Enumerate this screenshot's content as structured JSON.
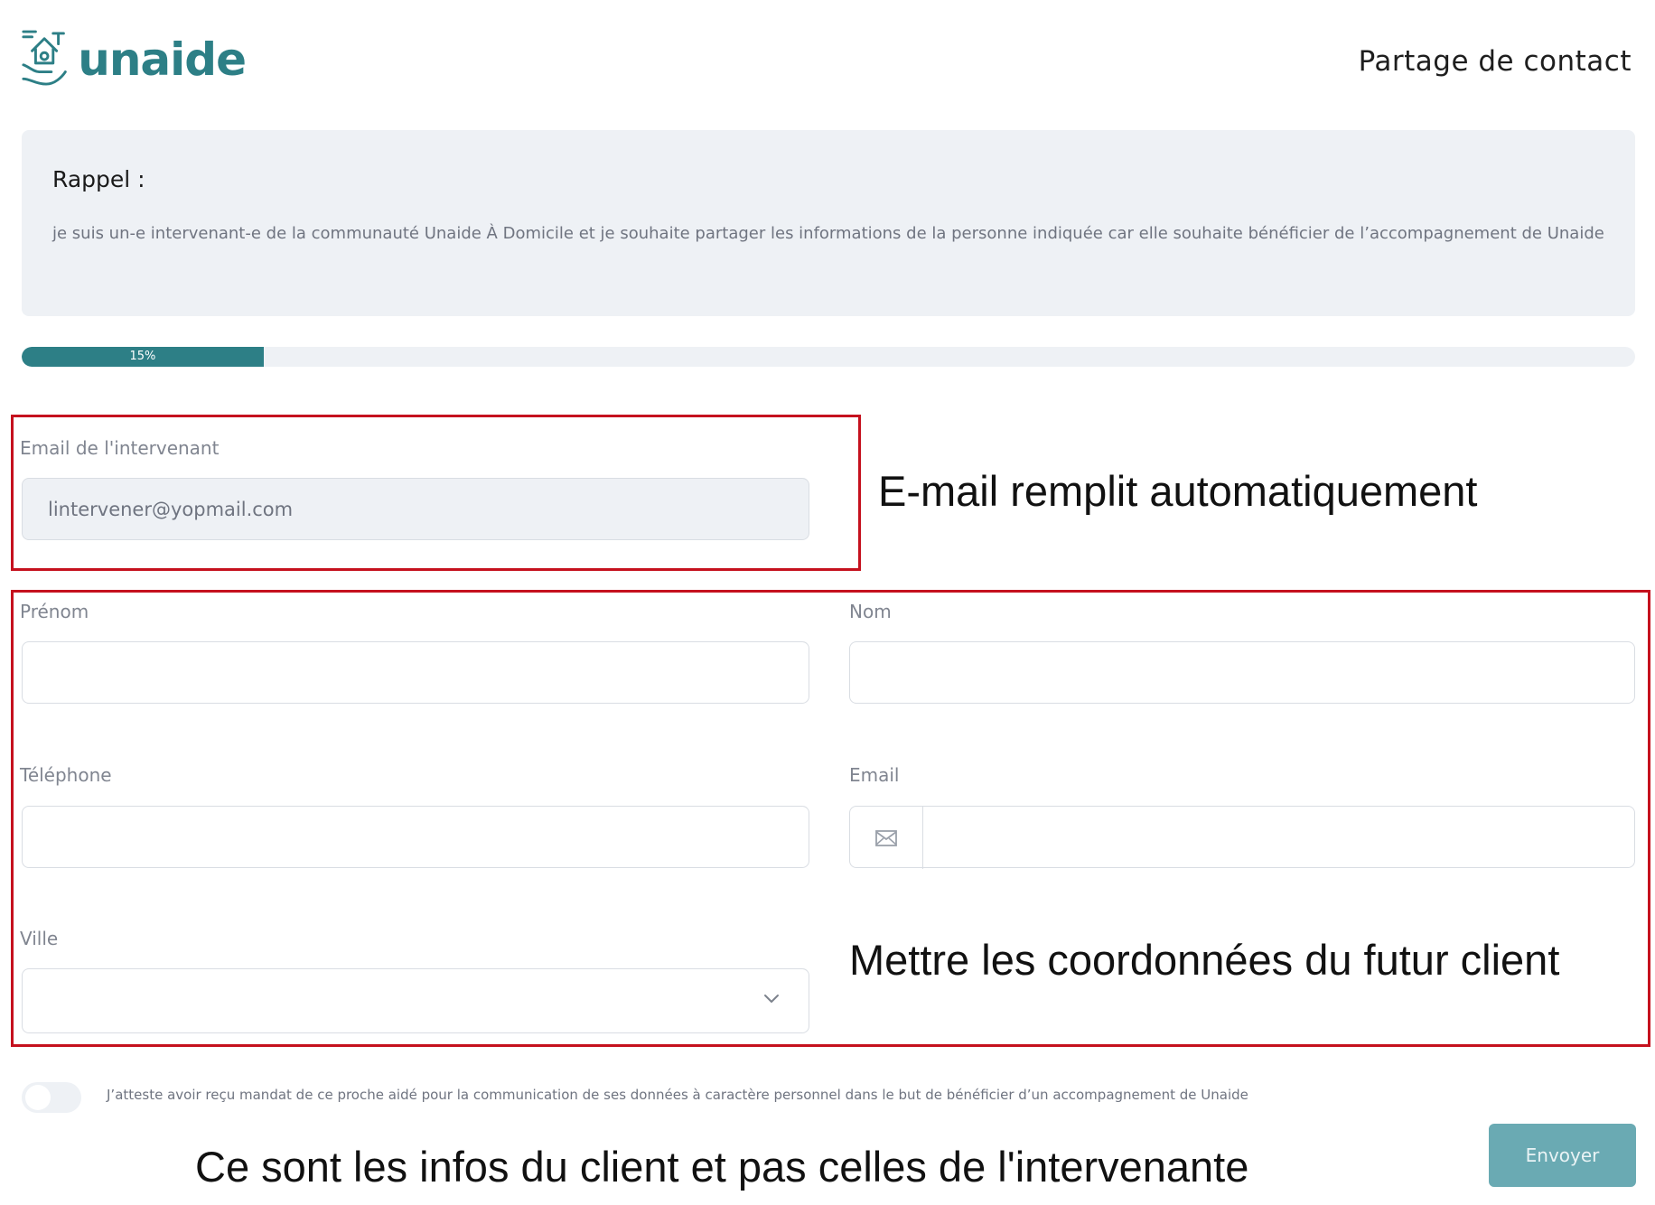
{
  "header": {
    "brand": "unaide",
    "title": "Partage de contact"
  },
  "reminder": {
    "heading": "Rappel :",
    "text": "je suis un-e intervenant-e de la communauté Unaide À Domicile et je souhaite partager les informations de la personne indiquée car elle souhaite bénéficier de l’accompagnement de Unaide"
  },
  "progress": {
    "label": "15%",
    "value_percent": 15
  },
  "form": {
    "intervenant_email_label": "Email de l'intervenant",
    "intervenant_email_value": "lintervener@yopmail.com",
    "prenom_label": "Prénom",
    "nom_label": "Nom",
    "telephone_label": "Téléphone",
    "email_label": "Email",
    "ville_label": "Ville",
    "consent_text": "J’atteste avoir reçu mandat de ce proche aidé pour la communication de ses données à caractère personnel dans le but de bénéficier d’un accompagnement de Unaide",
    "consent_checked": false,
    "submit_label": "Envoyer"
  },
  "annotations": {
    "email_auto": "E-mail remplit automatiquement",
    "client_coords": "Mettre les coordonnées du futur client",
    "client_info": "Ce sont les infos du client et pas celles de l'intervenante"
  },
  "colors": {
    "brand": "#2d7f86",
    "button": "#6aaab3",
    "panel": "#eef1f5",
    "annotation_red": "#c5111e"
  },
  "icons": [
    "hands-house-logo-icon",
    "envelope-icon",
    "chevron-down-icon"
  ]
}
